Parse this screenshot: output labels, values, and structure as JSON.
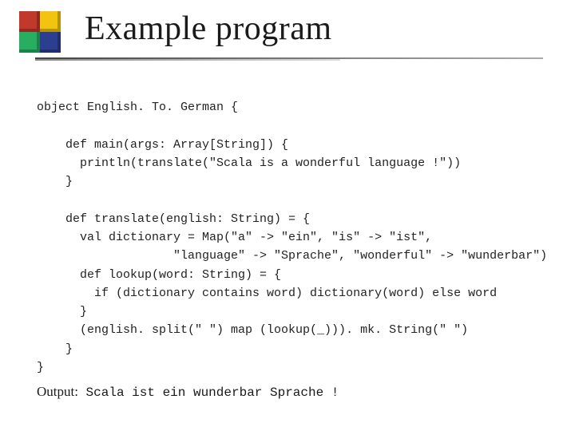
{
  "title": "Example program",
  "code": {
    "l1": "object English. To. German {",
    "l2": "    def main(args: Array[String]) {",
    "l3": "      println(translate(\"Scala is a wonderful language !\"))",
    "l4": "    }",
    "l5": "    def translate(english: String) = {",
    "l6": "      val dictionary = Map(\"a\" -> \"ein\", \"is\" -> \"ist\",",
    "l7": "                   \"language\" -> \"Sprache\", \"wonderful\" -> \"wunderbar\")",
    "l8": "      def lookup(word: String) = {",
    "l9": "        if (dictionary contains word) dictionary(word) else word",
    "l10": "      }",
    "l11": "      (english. split(\" \") map (lookup(_))). mk. String(\" \")",
    "l12": "    }",
    "l13": "}"
  },
  "output": {
    "label": "Output:",
    "text": " Scala ist ein wunderbar Sprache !"
  }
}
